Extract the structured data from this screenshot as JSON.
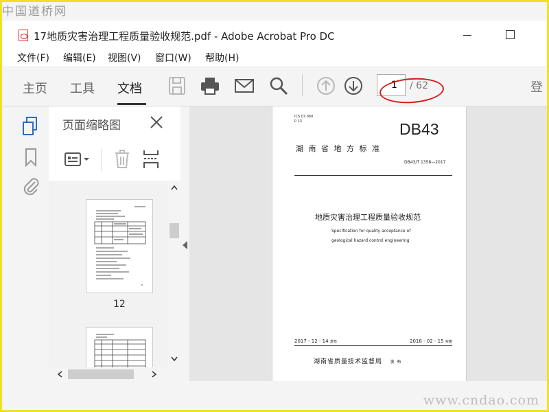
{
  "watermark": {
    "top": "中国道桥网",
    "bottom": "www.cndao.com"
  },
  "window": {
    "title": "17地质灾害治理工程质量验收规范.pdf - Adobe Acrobat Pro DC"
  },
  "menu": [
    {
      "label": "文件(F)"
    },
    {
      "label": "编辑(E)"
    },
    {
      "label": "视图(V)"
    },
    {
      "label": "窗口(W)"
    },
    {
      "label": "帮助(H)"
    }
  ],
  "toolbar": {
    "tabs": [
      {
        "label": "主页"
      },
      {
        "label": "工具"
      },
      {
        "label": "文档"
      }
    ],
    "page_number": "1",
    "page_total": "/ 62",
    "cut_text": "登",
    "icons": [
      "save-icon",
      "print-icon",
      "email-icon",
      "search-icon",
      "page-up-icon",
      "page-down-icon"
    ]
  },
  "panel": {
    "title": "页面缩略图",
    "thumbnail_label": "12"
  },
  "document": {
    "ics": "ICS 07.060",
    "p": "P 13",
    "code": "DB43",
    "region": "湖  南  省  地  方  标  准",
    "std_no": "DB43/T 1358—2017",
    "title_cn": "地质灾害治理工程质量验收规范",
    "title_en_1": "Specification for quality acceptance of",
    "title_en_2": "geological hazard control engineering",
    "issue_date": "2017 - 12 - 14",
    "issue_label": "发布",
    "impl_date": "2018 - 02 - 15",
    "impl_label": "实施",
    "issuer": "湖南省质量技术监督局",
    "issuer_suffix": "发 布"
  },
  "colors": {
    "highlight": "#d41e1e",
    "frame": "#f0e02a",
    "disabled_icon": "#b8b8b8",
    "icon": "#555555",
    "accent_blue": "#2b6cc4"
  }
}
